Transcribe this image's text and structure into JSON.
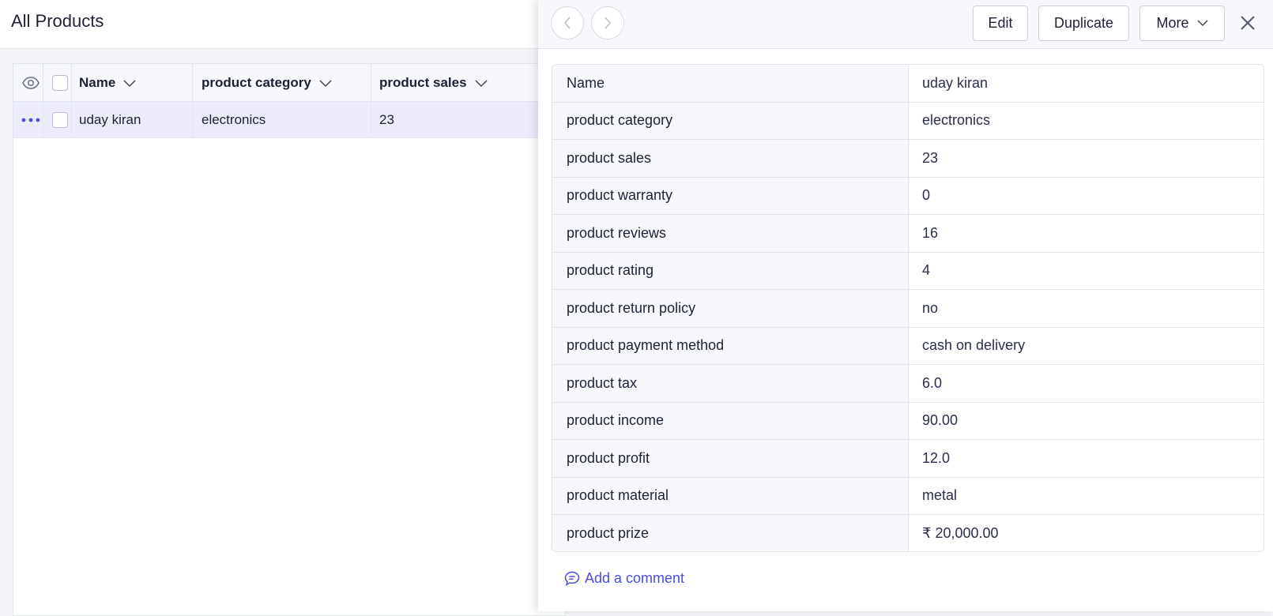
{
  "page": {
    "title": "All Products"
  },
  "grid": {
    "columns": [
      {
        "label": "Name"
      },
      {
        "label": "product category"
      },
      {
        "label": "product sales"
      }
    ],
    "rows": [
      {
        "name": "uday kiran",
        "category": "electronics",
        "sales": "23"
      }
    ]
  },
  "panel": {
    "toolbar": {
      "edit": "Edit",
      "duplicate": "Duplicate",
      "more": "More"
    },
    "fields": [
      {
        "label": "Name",
        "value": "uday kiran"
      },
      {
        "label": "product category",
        "value": "electronics"
      },
      {
        "label": "product sales",
        "value": "23"
      },
      {
        "label": "product warranty",
        "value": "0"
      },
      {
        "label": "product reviews",
        "value": "16"
      },
      {
        "label": "product rating",
        "value": "4"
      },
      {
        "label": "product return policy",
        "value": "no"
      },
      {
        "label": "product payment method",
        "value": "cash on delivery"
      },
      {
        "label": "product tax",
        "value": "6.0"
      },
      {
        "label": "product income",
        "value": "90.00"
      },
      {
        "label": "product profit",
        "value": "12.0"
      },
      {
        "label": "product material",
        "value": "metal"
      },
      {
        "label": "product prize",
        "value": "₹ 20,000.00"
      }
    ],
    "comment_link": "Add a comment"
  },
  "colors": {
    "accent": "#4b4de0",
    "row_selected": "#ebebfc",
    "border": "#e3e5ec"
  }
}
